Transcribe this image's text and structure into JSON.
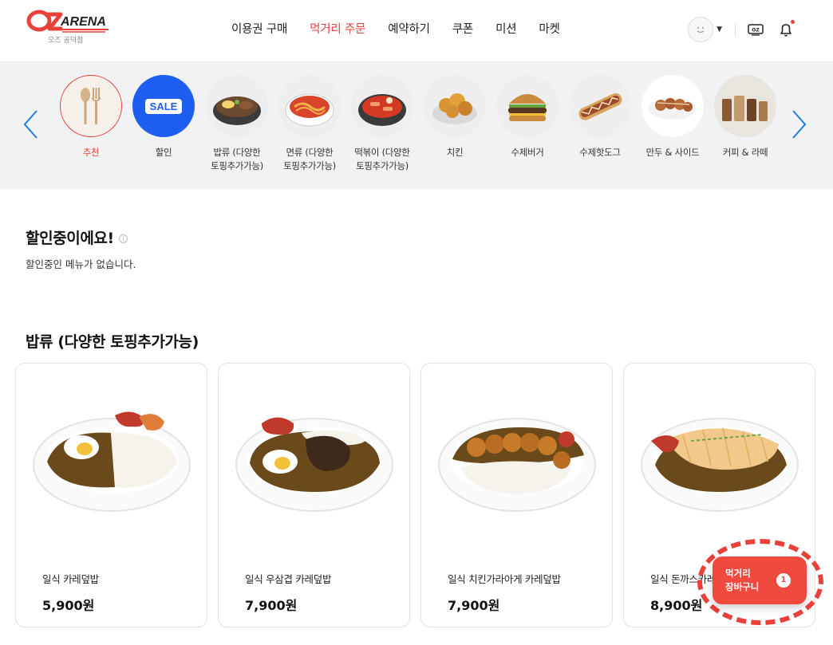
{
  "brand": {
    "logo_text": "OZARENA",
    "branch": "오즈 공덕점",
    "colors": {
      "accent": "#e8413a",
      "cart": "#f04a3f",
      "link_blue": "#1e7be6"
    }
  },
  "nav": {
    "items": [
      {
        "label": "이용권 구매"
      },
      {
        "label": "먹거리 주문"
      },
      {
        "label": "예약하기"
      },
      {
        "label": "쿠폰"
      },
      {
        "label": "미션"
      },
      {
        "label": "마켓"
      }
    ],
    "active_index": 1
  },
  "header_icons": {
    "profile": "smiley-avatar-icon",
    "dropdown": "caret-down-icon",
    "oz": "oz-card-icon",
    "notifications": "bell-icon"
  },
  "categories": {
    "prev": "chevron-left-icon",
    "next": "chevron-right-icon",
    "items": [
      {
        "line1": "추천",
        "line2": "",
        "icon": "cutlery-icon"
      },
      {
        "line1": "할인",
        "line2": "",
        "icon": "sale-icon",
        "badge": "SALE"
      },
      {
        "line1": "밥류 (다양한",
        "line2": "토핑추가가능)",
        "icon": "rice-bowl-icon"
      },
      {
        "line1": "면류 (다양한",
        "line2": "토핑추가가능)",
        "icon": "noodle-icon"
      },
      {
        "line1": "떡볶이 (다양한",
        "line2": "토핑추가가능)",
        "icon": "tteokbokki-icon"
      },
      {
        "line1": "치킨",
        "line2": "",
        "icon": "chicken-icon"
      },
      {
        "line1": "수제버거",
        "line2": "",
        "icon": "burger-icon"
      },
      {
        "line1": "수제핫도그",
        "line2": "",
        "icon": "hotdog-icon"
      },
      {
        "line1": "만두 & 사이드",
        "line2": "",
        "icon": "takoyaki-icon"
      },
      {
        "line1": "커피 & 라떼",
        "line2": "",
        "icon": "coffee-icon"
      }
    ]
  },
  "discount_section": {
    "title": "할인중이에요!",
    "info_icon": "info-icon",
    "empty_message": "할인중인 메뉴가 없습니다."
  },
  "rice_section": {
    "title": "밥류 (다양한 토핑추가가능)",
    "items": [
      {
        "name": "일식 카레덮밥",
        "price": "5,900원"
      },
      {
        "name": "일식 우삼겹 카레덮밥",
        "price": "7,900원"
      },
      {
        "name": "일식 치킨가라아게 카레덮밥",
        "price": "7,900원"
      },
      {
        "name": "일식 돈까스카레",
        "price": "8,900원"
      }
    ]
  },
  "cart": {
    "line1": "먹거리",
    "line2": "장바구니",
    "count": "1"
  }
}
